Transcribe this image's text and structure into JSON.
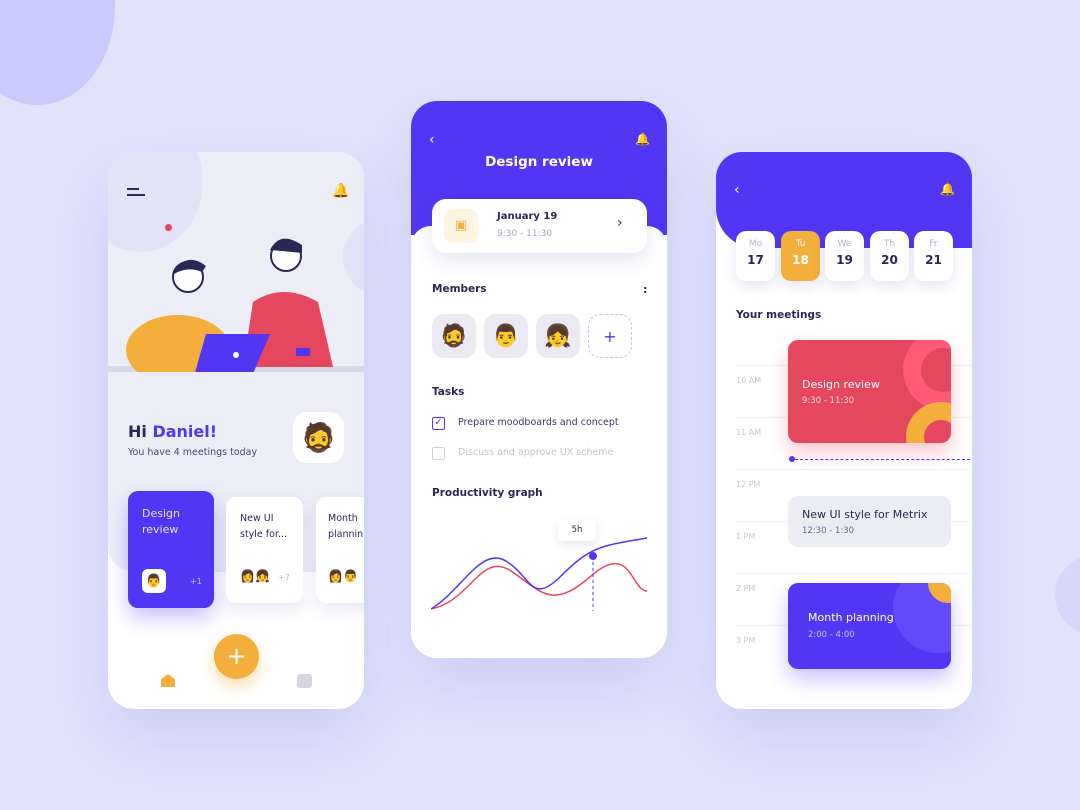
{
  "home": {
    "greeting": "Hi ",
    "name": "Daniel!",
    "subtitle": "You have 4 meetings today",
    "cards": [
      {
        "title_l1": "Design",
        "title_l2": "review",
        "extra": "+1"
      },
      {
        "title_l1": "New UI",
        "title_l2": "style for...",
        "extra": "+7"
      },
      {
        "title_l1": "Month",
        "title_l2": "plannin"
      }
    ],
    "fab": "+"
  },
  "detail": {
    "title": "Design review",
    "date": "January 19",
    "time": "9:30 - 11:30",
    "members_label": "Members",
    "more": ":",
    "add": "+",
    "tasks_label": "Tasks",
    "tasks": [
      {
        "label": "Prepare moodboards and concept",
        "done": true
      },
      {
        "label": "Discuss and approve UX scheme",
        "done": false
      }
    ],
    "graph_label": "Productivity graph",
    "tooltip": "5h"
  },
  "schedule": {
    "days": [
      {
        "d": "Mo",
        "n": "17"
      },
      {
        "d": "Tu",
        "n": "18"
      },
      {
        "d": "We",
        "n": "19"
      },
      {
        "d": "Th",
        "n": "20"
      },
      {
        "d": "Fr",
        "n": "21"
      }
    ],
    "selected_day": "18",
    "meetings_label": "Your meetings",
    "hours": [
      "10 AM",
      "11 AM",
      "12 PM",
      "1 PM",
      "2 PM",
      "3 PM"
    ],
    "meetings": [
      {
        "title": "Design review",
        "time": "9:30 - 11:30",
        "color": "#e5475e"
      },
      {
        "title": "New UI style for Metrix",
        "time": "12:30 - 1:30",
        "color": "#ececf3"
      },
      {
        "title": "Month planning",
        "time": "2:00 - 4:00",
        "color": "#5236f3"
      }
    ]
  },
  "colors": {
    "primary": "#5236f3",
    "accent": "#f4ae3c",
    "red": "#e5475e",
    "bg": "#e1e3fb"
  }
}
